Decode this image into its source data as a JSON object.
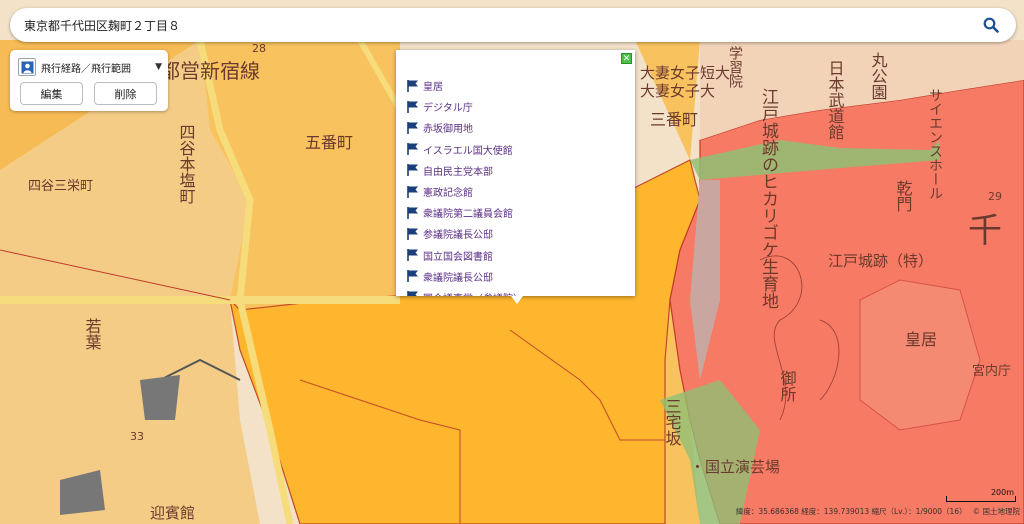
{
  "search": {
    "address": "東京都千代田区麹町２丁目８"
  },
  "layer_panel": {
    "title": "飛行経路／飛行範囲",
    "edit_label": "編集",
    "delete_label": "削除"
  },
  "popup": {
    "items": [
      "皇居",
      "デジタル庁",
      "赤坂御用地",
      "イスラエル国大使館",
      "自由民主党本部",
      "憲政記念館",
      "衆議院第二議員会館",
      "参議院議長公邸",
      "国立国会図書館",
      "衆議院議長公邸",
      "国会議事堂（参議院）"
    ]
  },
  "status": {
    "coords": "緯度：35.686368 経度：139.739013 縮尺（Lv.）：1/9000（16）",
    "attribution": "© 国土地理院"
  },
  "scale": {
    "label": "200m"
  },
  "map_labels": {
    "shinjuku_line": "都営新宿線",
    "yotsuya_sankei": "四谷三栄町",
    "yotsuya_honshio": "四谷本塩町",
    "goban": "五番町",
    "sanban": "三番町",
    "edojo_hikari": "江戸城跡のヒカリゴケ生育地",
    "edojo": "江戸城跡（特）",
    "kokyo": "皇居",
    "gosho": "御所",
    "kunaicho": "宮内庁",
    "science_hall": "サイエンスホール",
    "inui_gate": "乾門",
    "otsuma": "大妻女子短大",
    "otsuma2": "大妻女子大",
    "budokan": "日本武道館",
    "maru": "丸公園",
    "kokuritsu": "・国立演芸場",
    "miyakezaka": "三宅坂",
    "wakaba": "若葉",
    "gakushuin": "学習院",
    "geihinkan": "迎賓館",
    "chi": "千",
    "mark_28": "28",
    "mark_29": "29",
    "mark_33": "33"
  },
  "colors": {
    "deep_orange": "#fdb62e",
    "mid_orange": "#f8c25f",
    "light_orange": "#f4cc86",
    "salmon": "#f77b64",
    "green": "#8fbf74",
    "road": "#f6dc7a",
    "text_brown": "#6b3a2e",
    "popup_text": "#5b2f86"
  },
  "icons": {
    "search": "search-icon",
    "flag": "flag-icon",
    "route": "route-icon",
    "close": "close-icon",
    "caret": "caret-down-icon"
  }
}
